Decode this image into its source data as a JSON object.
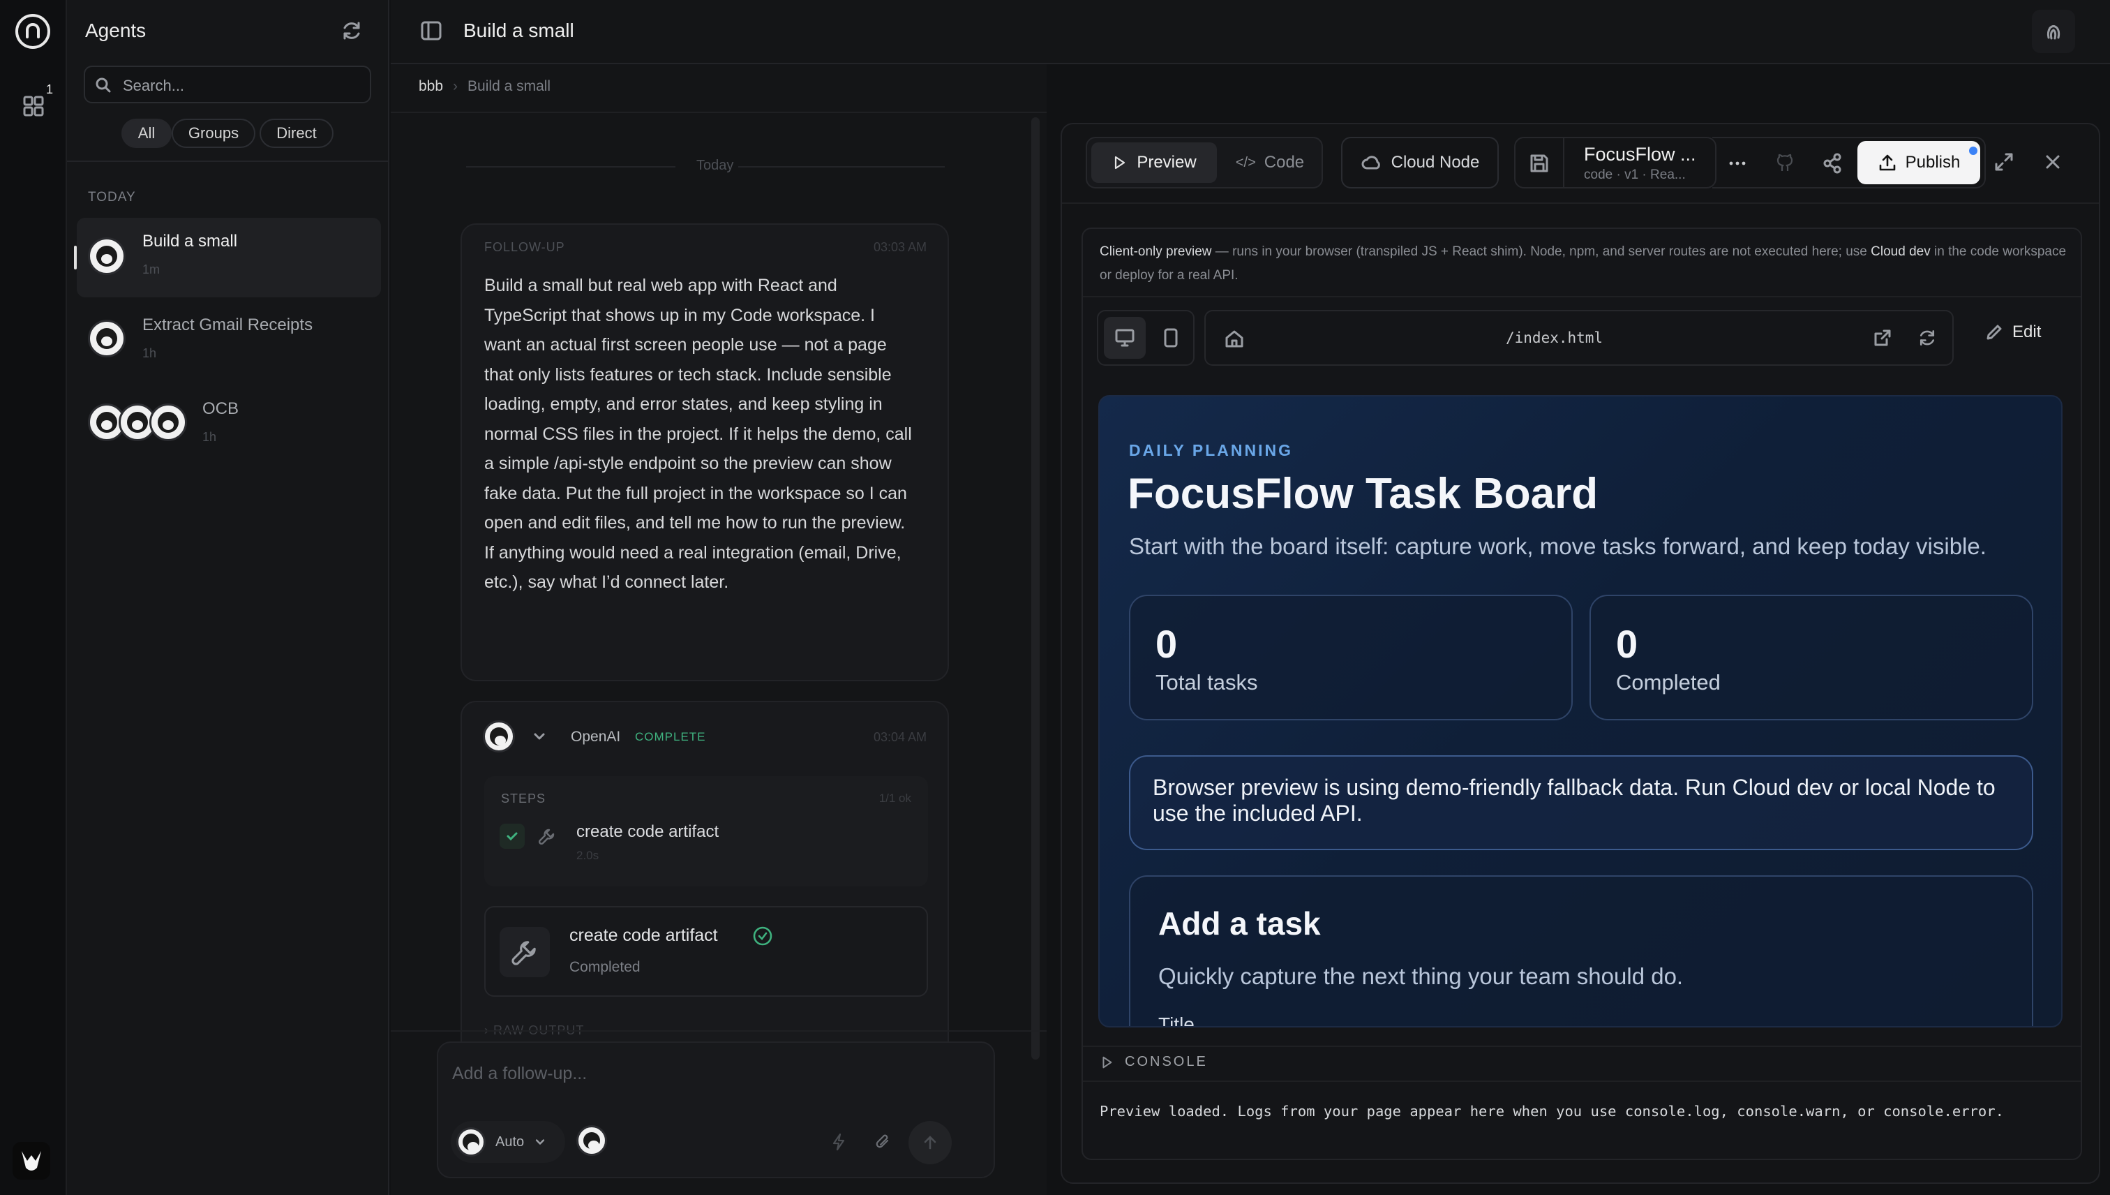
{
  "rail": {
    "badge": "1"
  },
  "sidebar": {
    "title": "Agents",
    "search_placeholder": "Search...",
    "filters": [
      "All",
      "Groups",
      "Direct"
    ],
    "section": "TODAY",
    "items": [
      {
        "title": "Build a small",
        "time": "1m"
      },
      {
        "title": "Extract Gmail Receipts",
        "time": "1h"
      },
      {
        "title": "OCB",
        "time": "1h"
      }
    ]
  },
  "header": {
    "title": "Build a small",
    "breadcrumb": [
      "bbb",
      "Build a small"
    ]
  },
  "chat": {
    "divider": "Today",
    "message": {
      "label": "FOLLOW-UP",
      "time": "03:03 AM",
      "lines": [
        "Build a small but real web app with React and",
        "TypeScript that shows up in my Code workspace. I",
        "want an actual first screen people use — not a page",
        "that only lists features or tech stack. Include sensible",
        "loading, empty, and error states, and keep styling in",
        "normal CSS files in the project. If it helps the demo, call",
        "a simple /api-style endpoint so the preview can show",
        "fake data. Put the full project in the workspace so I can",
        "open and edit files, and tell me how to run the preview.",
        "If anything would need a real integration (email, Drive,",
        "etc.), say what I’d connect later."
      ]
    },
    "reply": {
      "agent": "OpenAI",
      "status": "COMPLETE",
      "time": "03:04 AM",
      "steps_label": "STEPS",
      "steps_count": "1/1 ok",
      "step": {
        "name": "create code artifact",
        "duration": "2.0s"
      },
      "tool": {
        "name": "create code artifact",
        "status": "Completed"
      },
      "raw": "RAW OUTPUT"
    },
    "composer": {
      "placeholder": "Add a follow-up...",
      "mode": "Auto"
    }
  },
  "panel": {
    "tabs": {
      "preview": "Preview",
      "code": "Code",
      "cloud": "Cloud Node"
    },
    "artifact": {
      "title": "FocusFlow ...",
      "subtitle": "code · v1 · Rea..."
    },
    "publish": "Publish",
    "notice_bold1": "Client-only preview",
    "notice_mid": " — runs in your browser (transpiled JS + React shim). Node, npm, and server routes are not executed here; use ",
    "notice_bold2": "Cloud dev",
    "notice_end": " in the code workspace or deploy for a real API.",
    "url": "/index.html",
    "edit": "Edit",
    "console_label": "CONSOLE",
    "console_text": "Preview loaded. Logs from your page appear here when you use console.log, console.warn, or console.error."
  },
  "app": {
    "eyebrow": "DAILY PLANNING",
    "title": "FocusFlow Task Board",
    "subtitle": "Start with the board itself: capture work, move tasks forward, and keep today visible.",
    "stats": [
      {
        "value": "0",
        "label": "Total tasks"
      },
      {
        "value": "0",
        "label": "Completed"
      }
    ],
    "banner": "Browser preview is using demo-friendly fallback data. Run Cloud dev or local Node to use the included API.",
    "add_title": "Add a task",
    "add_sub": "Quickly capture the next thing your team should do.",
    "field_label": "Title"
  },
  "colors": {
    "accent_green": "#3fb27f",
    "publish_dot": "#3b82f6",
    "app_bg": "#0f1f3a"
  }
}
